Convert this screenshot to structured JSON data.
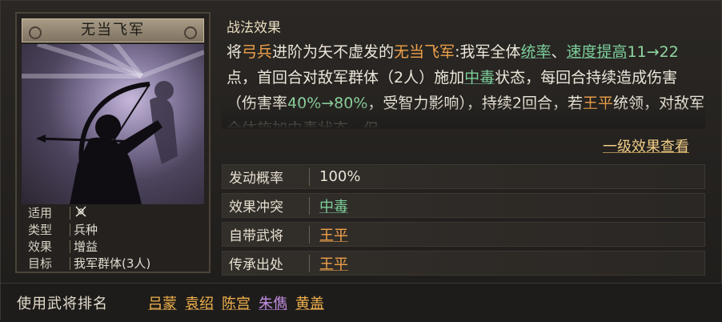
{
  "card": {
    "name": "无当飞军",
    "info": [
      {
        "key": "适用",
        "value": "",
        "icon": "bow-crossbow-icon"
      },
      {
        "key": "类型",
        "value": "兵种"
      },
      {
        "key": "效果",
        "value": "增益"
      },
      {
        "key": "目标",
        "value": "我军群体(3人)"
      }
    ]
  },
  "effect": {
    "title": "战法效果",
    "segments": [
      {
        "t": "将",
        "c": "normal"
      },
      {
        "t": "弓兵",
        "c": "orange"
      },
      {
        "t": "进阶为矢不虚发的",
        "c": "normal"
      },
      {
        "t": "无当飞军",
        "c": "orange"
      },
      {
        "t": ":我军全体",
        "c": "normal"
      },
      {
        "t": "统率",
        "c": "green"
      },
      {
        "t": "、",
        "c": "normal"
      },
      {
        "t": "速度提高",
        "c": "green"
      },
      {
        "t": "11→22",
        "c": "pct"
      },
      {
        "t": "点，首回合对敌军群体（2人）施加",
        "c": "normal"
      },
      {
        "t": "中毒",
        "c": "green"
      },
      {
        "t": "状态，每回合持续造成伤害（伤害率",
        "c": "normal"
      },
      {
        "t": "40%→80%",
        "c": "pct"
      },
      {
        "t": "，受智力影响），持续2回合，若",
        "c": "normal"
      },
      {
        "t": "王平",
        "c": "orange"
      },
      {
        "t": "统领，对敌军全体施加中毒状态，但",
        "c": "normal"
      }
    ],
    "level_button": "一级效果查看"
  },
  "rows": [
    {
      "key": "发动概率",
      "value": "100%",
      "style": "white"
    },
    {
      "key": "效果冲突",
      "value": "中毒",
      "style": "green"
    },
    {
      "key": "自带武将",
      "value": "王平",
      "style": "orange"
    },
    {
      "key": "传承出处",
      "value": "王平",
      "style": "orange"
    }
  ],
  "bottom": {
    "label": "使用武将排名",
    "generals": [
      {
        "name": "吕蒙",
        "color": "orange"
      },
      {
        "name": "袁绍",
        "color": "orange"
      },
      {
        "name": "陈宫",
        "color": "orange"
      },
      {
        "name": "朱儁",
        "color": "purple"
      },
      {
        "name": "黄盖",
        "color": "orange"
      }
    ]
  }
}
